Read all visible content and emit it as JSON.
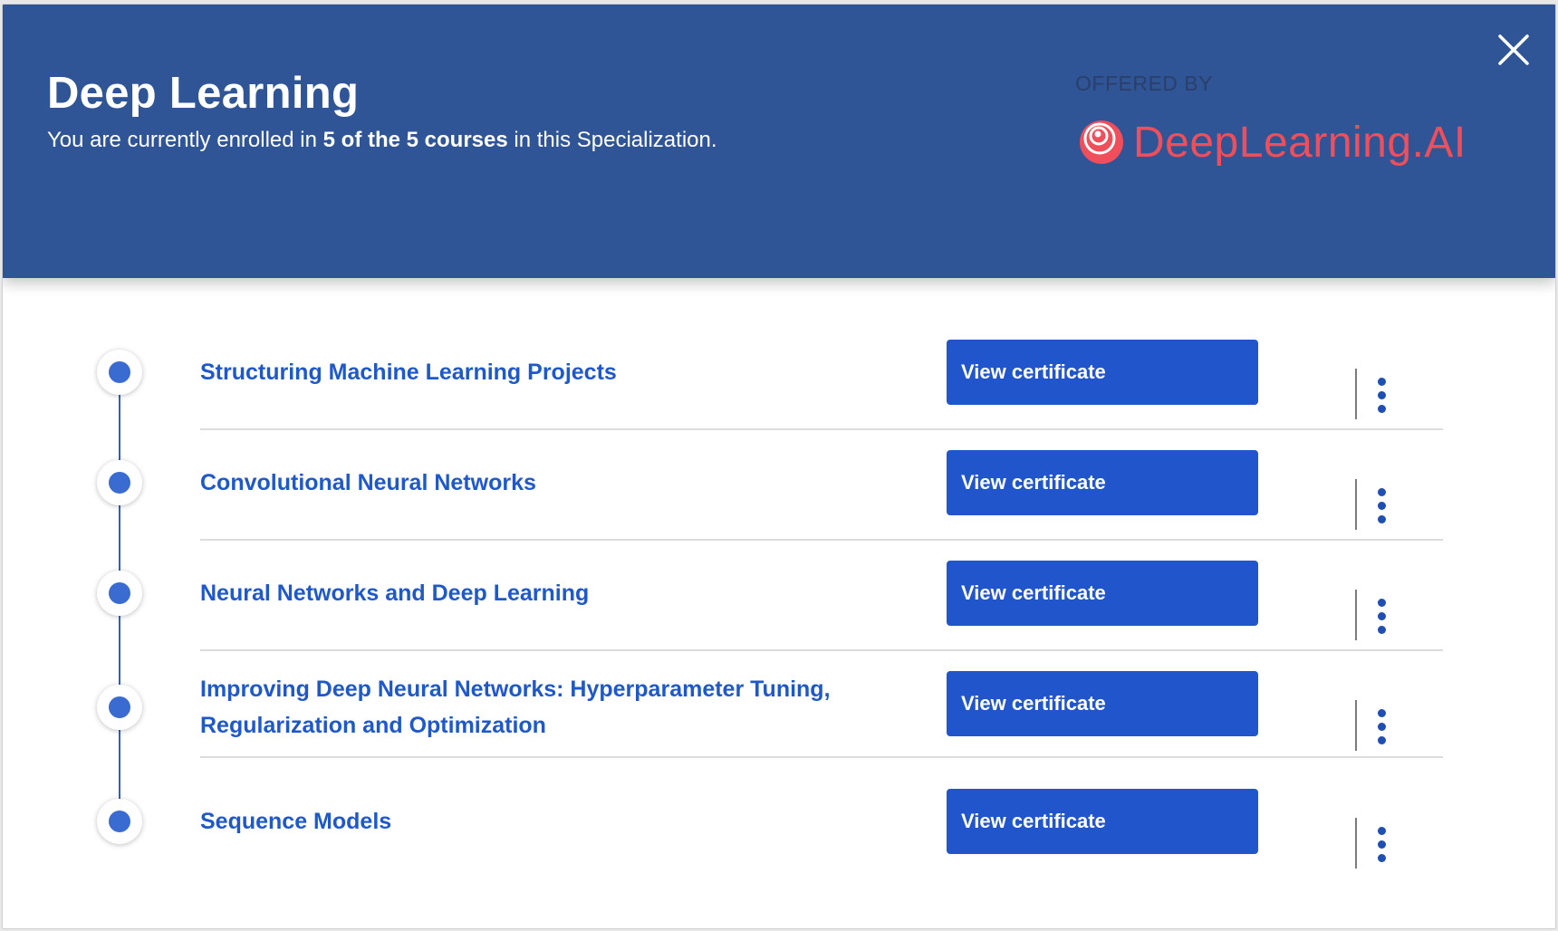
{
  "header": {
    "title": "Deep Learning",
    "subtitle_prefix": "You are currently enrolled in ",
    "subtitle_bold": "5 of the 5 courses",
    "subtitle_suffix": " in this Specialization.",
    "offered_by": "OFFERED BY",
    "partner_name": "DeepLearning.AI",
    "close_icon": "close-icon",
    "colors": {
      "banner": "#2f5597",
      "partner": "#f04e5a"
    }
  },
  "courses": [
    {
      "title": "Structuring Machine Learning Projects",
      "button_label": "View certificate"
    },
    {
      "title": "Convolutional Neural Networks",
      "button_label": "View certificate"
    },
    {
      "title": "Neural Networks and Deep Learning",
      "button_label": "View certificate"
    },
    {
      "title": "Improving Deep Neural Networks: Hyperparameter Tuning, Regularization and Optimization",
      "button_label": "View certificate"
    },
    {
      "title": "Sequence Models",
      "button_label": "View certificate"
    }
  ],
  "colors": {
    "link": "#1f59c9",
    "button": "#2155cc",
    "timeline": "#3a6bd0"
  }
}
